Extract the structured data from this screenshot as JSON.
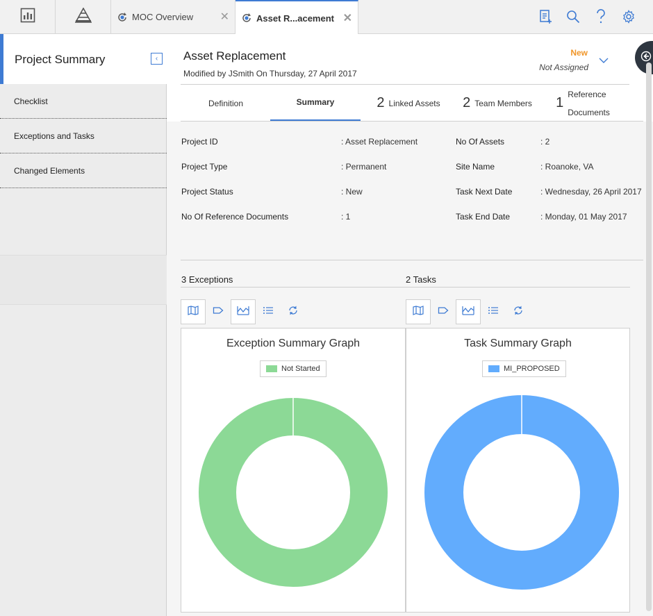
{
  "tabs": [
    {
      "label": "MOC Overview"
    },
    {
      "label": "Asset R...acement"
    }
  ],
  "left_panel": {
    "title": "Project Summary",
    "items": [
      {
        "label": "Checklist"
      },
      {
        "label": "Exceptions and Tasks"
      },
      {
        "label": "Changed Elements"
      }
    ]
  },
  "header": {
    "title": "Asset Replacement",
    "modified": "Modified by JSmith On Thursday, 27 April 2017",
    "state": "New",
    "assigned": "Not Assigned"
  },
  "section_tabs": [
    {
      "label": "Definition"
    },
    {
      "label": "Summary"
    },
    {
      "count": "2",
      "label": "Linked Assets"
    },
    {
      "count": "2",
      "label": "Team Members"
    },
    {
      "count": "1",
      "label_line1": "Reference",
      "label_line2": "Documents"
    }
  ],
  "details": {
    "left": [
      {
        "label": "Project ID",
        "value": ": Asset Replacement"
      },
      {
        "label": "Project Type",
        "value": ": Permanent"
      },
      {
        "label": "Project Status",
        "value": ": New"
      },
      {
        "label": "No Of Reference Documents",
        "value": ": 1"
      }
    ],
    "right": [
      {
        "label": "No Of Assets",
        "value": ": 2"
      },
      {
        "label": "Site Name",
        "value": ": Roanoke, VA"
      },
      {
        "label": "Task Next Date",
        "value": ": Wednesday, 26 April 2017"
      },
      {
        "label": "Task End Date",
        "value": ": Monday, 01 May 2017"
      }
    ]
  },
  "exceptions_section": {
    "title": "3 Exceptions"
  },
  "tasks_section": {
    "title": "2 Tasks"
  },
  "colors": {
    "accent": "#3e7bd3",
    "state": "#f0962a",
    "exception_series": "#8cd996",
    "task_series": "#62acfd"
  },
  "chart_data": [
    {
      "type": "pie",
      "title": "Exception Summary Graph",
      "categories": [
        "Not Started"
      ],
      "values": [
        3
      ],
      "colors": [
        "#8cd996"
      ],
      "legend": "top"
    },
    {
      "type": "pie",
      "title": "Task Summary Graph",
      "categories": [
        "MI_PROPOSED"
      ],
      "values": [
        2
      ],
      "colors": [
        "#62acfd"
      ],
      "legend": "top"
    }
  ]
}
